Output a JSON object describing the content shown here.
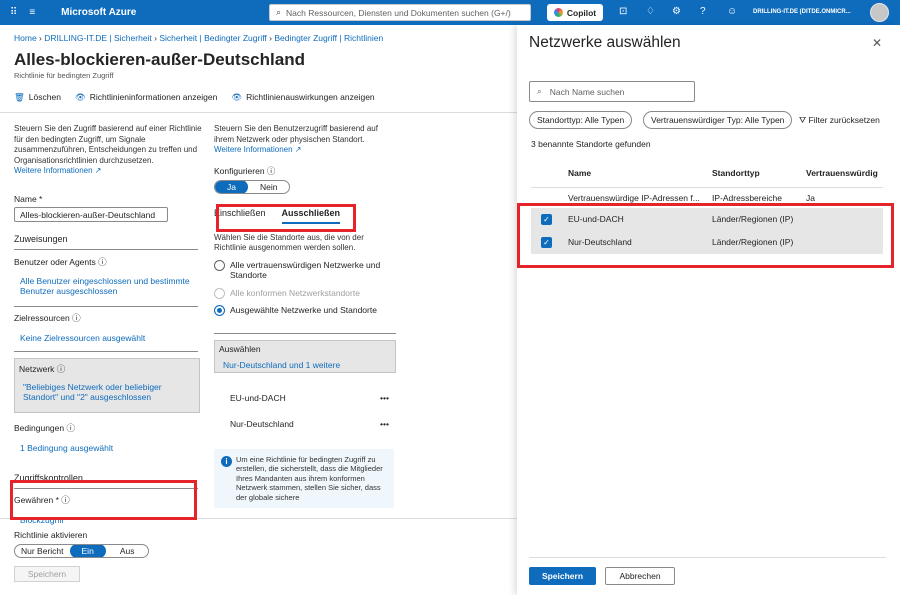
{
  "topbar": {
    "brand": "Microsoft Azure",
    "search_placeholder": "Nach Ressourcen, Diensten und Dokumenten suchen (G+/)",
    "copilot_label": "Copilot",
    "account": "DRILLING-IT.DE (DITDE.ONMICR..."
  },
  "breadcrumb": [
    "Home",
    "DRILLING-IT.DE | Sicherheit",
    "Sicherheit | Bedingter Zugriff",
    "Bedingter Zugriff | Richtlinien"
  ],
  "page": {
    "title": "Alles-blockieren-außer-Deutschland",
    "more": "···",
    "subtitle": "Richtlinie für bedingten Zugriff",
    "toolbar": {
      "delete": "Löschen",
      "info": "Richtlinieninformationen anzeigen",
      "impact": "Richtlinienauswirkungen anzeigen"
    }
  },
  "left": {
    "desc": "Steuern Sie den Zugriff basierend auf einer Richtlinie für den bedingten Zugriff, um Signale zusammenzuführen, Entscheidungen zu treffen und Organisationsrichtlinien durchzusetzen.",
    "learn_more": "Weitere Informationen ↗",
    "name_label": "Name *",
    "name_value": "Alles-blockieren-außer-Deutschland",
    "assignments": "Zuweisungen",
    "users_label": "Benutzer oder Agents ⓘ",
    "users_value": "Alle Benutzer eingeschlossen und bestimmte Benutzer ausgeschlossen",
    "targets_label": "Zielressourcen ⓘ",
    "targets_value": "Keine Zielressourcen ausgewählt",
    "network_label": "Netzwerk ⓘ",
    "network_value": "\"Beliebiges Netzwerk oder beliebiger Standort\" und \"2\" ausgeschlossen",
    "conditions_label": "Bedingungen ⓘ",
    "conditions_value": "1 Bedingung ausgewählt",
    "access_controls": "Zugriffskontrollen",
    "grant_label": "Gewähren * ⓘ",
    "grant_value": "Blockzugriff",
    "enable_label": "Richtlinie aktivieren",
    "enable_options": [
      "Nur Bericht",
      "Ein",
      "Aus"
    ],
    "save": "Speichern"
  },
  "middle": {
    "desc": "Steuern Sie den Benutzerzugriff basierend auf ihrem Netzwerk oder physischen Standort.",
    "learn_more": "Weitere Informationen ↗",
    "configure_label": "Konfigurieren ⓘ",
    "configure_options": [
      "Ja",
      "Nein"
    ],
    "tab_include": "Einschließen",
    "tab_exclude": "Ausschließen",
    "exclude_desc": "Wählen Sie die Standorte aus, die von der Richtlinie ausgenommen werden sollen.",
    "radio_trusted": "Alle vertrauenswürdigen Netzwerke und Standorte",
    "radio_compliant": "Alle konformen Netzwerkstandorte",
    "radio_selected": "Ausgewählte Netzwerke und Standorte",
    "select_label": "Auswählen",
    "select_value": "Nur-Deutschland und 1 weitere",
    "items": [
      "EU-und-DACH",
      "Nur-Deutschland"
    ],
    "item_more": "•••",
    "info": "Um eine Richtlinie für bedingten Zugriff zu erstellen, die sicherstellt, dass die Mitglieder Ihres Mandanten aus ihrem konformen Netzwerk stammen, stellen Sie sicher, dass der globale sichere"
  },
  "panel": {
    "title": "Netzwerke auswählen",
    "close": "✕",
    "search_placeholder": "Nach Name suchen",
    "chip_type": "Standorttyp: Alle Typen",
    "chip_trusted": "Vertrauenswürdiger Typ: Alle Typen",
    "reset": "Filter zurücksetzen",
    "found": "3 benannte Standorte gefunden",
    "columns": [
      "Name",
      "Standorttyp",
      "Vertrauenswürdig"
    ],
    "rows": [
      {
        "name": "Vertrauenswürdige IP-Adressen f...",
        "type": "IP-Adressbereiche",
        "trusted": "Ja",
        "selected": false
      },
      {
        "name": "EU-und-DACH",
        "type": "Länder/Regionen (IP)",
        "trusted": "",
        "selected": true
      },
      {
        "name": "Nur-Deutschland",
        "type": "Länder/Regionen (IP)",
        "trusted": "",
        "selected": true
      }
    ],
    "save": "Speichern",
    "cancel": "Abbrechen"
  },
  "colors": {
    "accent": "#0f6cbd",
    "highlight": "#e5232b"
  }
}
